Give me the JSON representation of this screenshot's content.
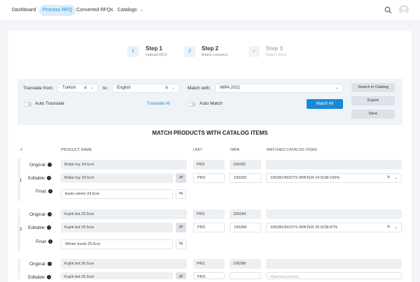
{
  "nav": {
    "items": [
      "Dashboard",
      "Process RFQ",
      "Converted RFQs",
      "Catalogs"
    ],
    "active_index": 1,
    "catalogs_caret": "⌄"
  },
  "steps": [
    {
      "num": "1",
      "title": "Step 1",
      "subtitle": "Upload RFQ",
      "state": "done"
    },
    {
      "num": "2",
      "title": "Step 2",
      "subtitle": "Match columns",
      "state": "current"
    },
    {
      "num": "✓",
      "title": "Step 3",
      "subtitle": "Match items",
      "state": "pending"
    }
  ],
  "controls": {
    "translate_from_label": "Translate from:",
    "translate_from_value": "Turkish",
    "to_label": "to:",
    "to_value": "English",
    "match_with_label": "Match with:",
    "match_with_value": "IMPA 2021",
    "auto_translate_label": "Auto Translate",
    "translate_all_label": "Translate All",
    "auto_match_label": "Auto Match",
    "match_all_label": "Match All",
    "search_catalog_label": "Search in Catalog",
    "export_label": "Export",
    "save_label": "Save"
  },
  "section_title": "MATCH PRODUCTS WITH CATALOG ITEMS",
  "table": {
    "headers": {
      "num": "#",
      "product": "PRODUCT NAME",
      "unit": "UNIT",
      "impa": "IMPA",
      "matched": "MATCHED CATALOG ITEMS"
    },
    "labels": {
      "original": "Original:",
      "editable": "Editable:",
      "final": "Final:"
    },
    "matched_placeholder": "Matched product",
    "rows": [
      {
        "num": "1",
        "original": "Botlar kış 24.5cm",
        "editable": "Botlar kış 24.5cm",
        "final": "boots winter 24.5cm",
        "unit_orig": "PRS",
        "unit_edit": "PRS",
        "impa_orig": "190282",
        "impa_edit": "190282",
        "matched": "190282-BOOTS WINTER 24.5CM-100%"
      },
      {
        "num": "2",
        "original": "Kışlık bot 25.5cm",
        "editable": "Kışlık bot 25.5cm",
        "final": "Winter boots 25.5cm",
        "unit_orig": "PRS",
        "unit_edit": "PRS",
        "impa_orig": "190284",
        "impa_edit": "190284",
        "matched": "190284-BOOTS WINTER 25.5CM-87%"
      },
      {
        "num": "3",
        "original": "Kışlık bot 26.5cm",
        "editable": "Kışlık bot 26.5cm",
        "final": "",
        "unit_orig": "PRS",
        "unit_edit": "PRS",
        "impa_orig": "190286",
        "impa_edit": "",
        "matched": ""
      }
    ]
  },
  "colors": {
    "accent": "#1a8ad4",
    "panel": "#eef3f8",
    "button_gray": "#dde2e8"
  },
  "icons": {
    "search": "search-icon",
    "avatar": "user-avatar-icon",
    "clear": "✕",
    "caret": "⌄",
    "translate": "translate-icon",
    "swap": "swap-icon"
  }
}
